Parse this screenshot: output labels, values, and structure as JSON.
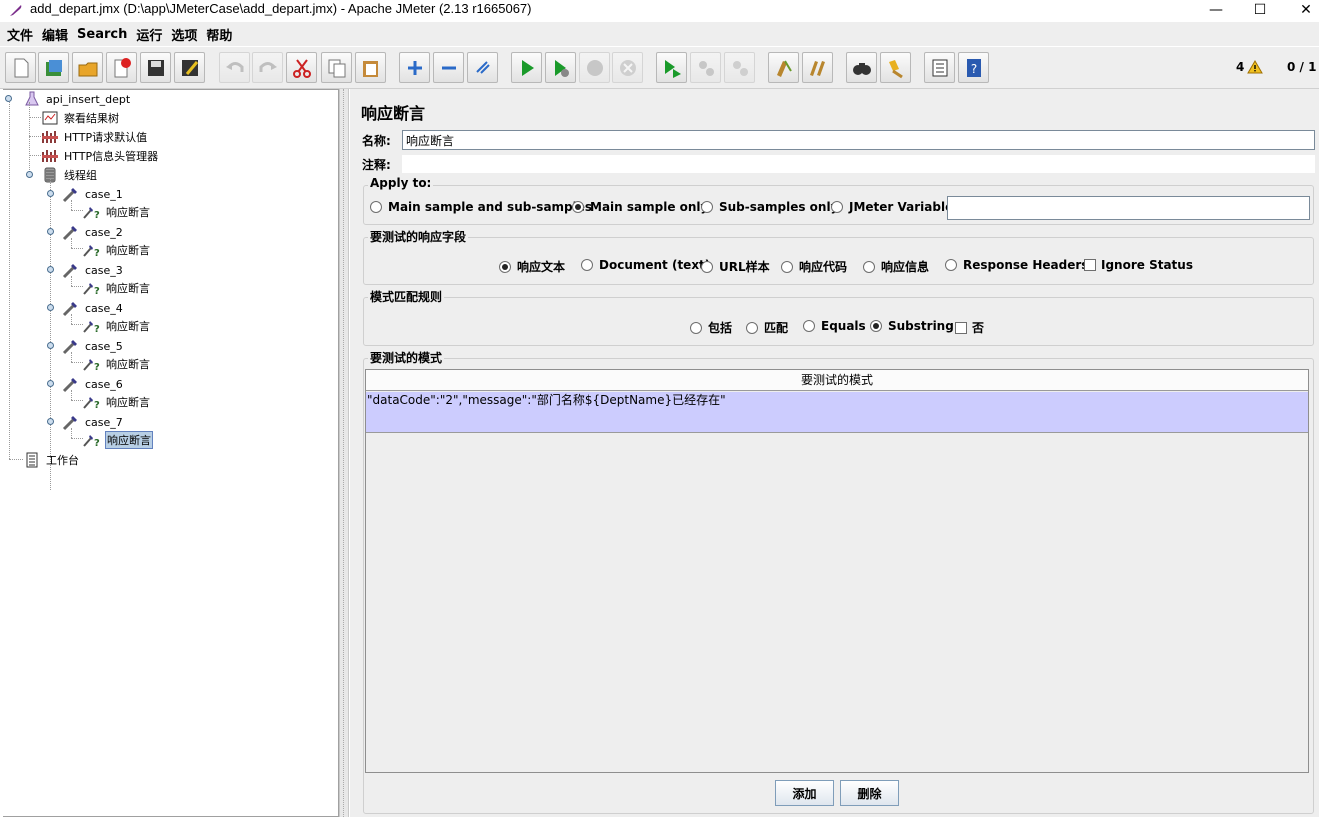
{
  "window": {
    "title": "add_depart.jmx (D:\\app\\JMeterCase\\add_depart.jmx) - Apache JMeter (2.13 r1665067)",
    "minimize": "—",
    "maximize": "☐",
    "close": "✕"
  },
  "menu": [
    "文件",
    "编辑",
    "Search",
    "运行",
    "选项",
    "帮助"
  ],
  "toolbar": {
    "buttons": [
      "new-icon",
      "templates-icon",
      "open-icon",
      "close-icon",
      "save-icon",
      "save-as-icon",
      "undo-icon",
      "redo-icon",
      "cut-icon",
      "copy-icon",
      "paste-icon",
      "expand-icon",
      "collapse-icon",
      "toggle-icon",
      "start-icon",
      "start-no-pause-icon",
      "stop-icon",
      "shutdown-icon",
      "remote-start-icon",
      "remote-stop-icon",
      "remote-shutdown-icon",
      "clear-icon",
      "clear-all-icon",
      "search-icon",
      "reset-search-icon",
      "function-helper-icon",
      "help-icon"
    ],
    "warning_count": "4",
    "threads": "0 / 1"
  },
  "tree": {
    "root": "api_insert_dept",
    "items": [
      {
        "label": "察看结果树",
        "icon": "view-results-icon"
      },
      {
        "label": "HTTP请求默认值",
        "icon": "config-icon"
      },
      {
        "label": "HTTP信息头管理器",
        "icon": "config-icon"
      },
      {
        "label": "线程组",
        "icon": "thread-group-icon"
      }
    ],
    "cases": [
      {
        "label": "case_1",
        "child": "响应断言"
      },
      {
        "label": "case_2",
        "child": "响应断言"
      },
      {
        "label": "case_3",
        "child": "响应断言"
      },
      {
        "label": "case_4",
        "child": "响应断言"
      },
      {
        "label": "case_5",
        "child": "响应断言"
      },
      {
        "label": "case_6",
        "child": "响应断言"
      },
      {
        "label": "case_7",
        "child": "响应断言"
      }
    ],
    "workbench": "工作台"
  },
  "panel": {
    "title": "响应断言",
    "name_label": "名称:",
    "name_value": "响应断言",
    "comment_label": "注释:",
    "apply_to": {
      "title": "Apply to:",
      "options": [
        "Main sample and sub-samples",
        "Main sample only",
        "Sub-samples only",
        "JMeter Variable"
      ],
      "selected": "Main sample only"
    },
    "response_field": {
      "title": "要测试的响应字段",
      "options": [
        "响应文本",
        "Document (text)",
        "URL样本",
        "响应代码",
        "响应信息",
        "Response Headers"
      ],
      "selected": "响应文本",
      "ignore_status": "Ignore Status"
    },
    "pattern_rules": {
      "title": "模式匹配规则",
      "options": [
        "包括",
        "匹配",
        "Equals",
        "Substring"
      ],
      "selected": "Substring",
      "not_label": "否"
    },
    "patterns": {
      "title": "要测试的模式",
      "column": "要测试的模式",
      "rows": [
        "\"dataCode\":\"2\",\"message\":\"部门名称${DeptName}已经存在\""
      ]
    },
    "add_button": "添加",
    "delete_button": "删除"
  }
}
